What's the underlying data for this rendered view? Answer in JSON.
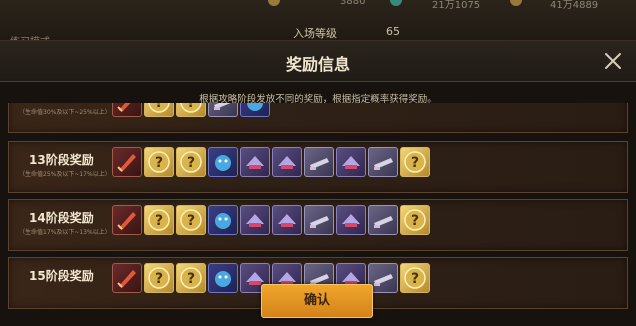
{
  "background": {
    "mode_label": "练习模式",
    "level_label": "入场等级",
    "level_value": "65",
    "resources": [
      "3880",
      "21万1075",
      "41万4889"
    ]
  },
  "modal": {
    "title": "奖励信息",
    "description": "根据攻略阶段发放不同的奖励，根据指定概率获得奖励。",
    "confirm_label": "确认"
  },
  "rows": [
    {
      "title": "",
      "subtitle": "（生命值30%及以下~25%以上）"
    },
    {
      "title": "13阶段奖励",
      "subtitle": "（生命值25%及以下~17%以上）"
    },
    {
      "title": "14阶段奖励",
      "subtitle": "（生命值17%及以下~13%以上）"
    },
    {
      "title": "15阶段奖励",
      "subtitle": ""
    }
  ],
  "item_sets": {
    "row0": [
      "sword",
      "mystery",
      "mystery",
      "silver",
      "pet"
    ],
    "full": [
      "sword",
      "mystery",
      "mystery",
      "pet",
      "purple",
      "purple",
      "silver",
      "purple",
      "silver",
      "mystery"
    ]
  },
  "colors": {
    "accent": "#f0a72c",
    "row_border": "#5a4330",
    "background": "#17120d"
  }
}
